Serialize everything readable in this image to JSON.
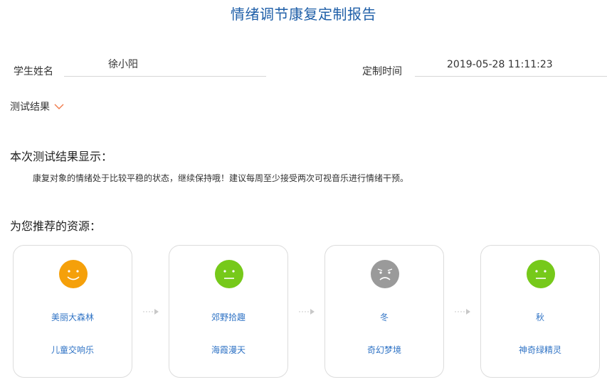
{
  "page": {
    "title": "情绪调节康复定制报告"
  },
  "student": {
    "label": "学生姓名",
    "value": "徐小阳"
  },
  "time": {
    "label": "定制时间",
    "value": "2019-05-28 11:11:23"
  },
  "test_result": {
    "toggle_label": "测试结果"
  },
  "summary": {
    "heading": "本次测试结果显示：",
    "text": "康复对象的情绪处于比较平稳的状态，继续保持哦！建议每周至少接受两次可视音乐进行情绪干预。"
  },
  "recommend": {
    "heading": "为您推荐的资源：",
    "cards": [
      {
        "face": "smile-face-icon",
        "color": "#f5a00a",
        "item1": "美丽大森林",
        "item2": "儿童交响乐"
      },
      {
        "face": "neutral-face-icon",
        "color": "#76c91a",
        "item1": "郊野拾趣",
        "item2": "海霞漫天"
      },
      {
        "face": "sad-face-icon",
        "color": "#9a9a9a",
        "item1": "冬",
        "item2": "奇幻梦境"
      },
      {
        "face": "neutral-face-icon",
        "color": "#76c91a",
        "item1": "秋",
        "item2": "神奇绿精灵"
      }
    ]
  },
  "colors": {
    "title": "#1f5fa8",
    "link": "#2f73c5",
    "chevron": "#f07a4a",
    "card_border": "#dcdcdc"
  }
}
